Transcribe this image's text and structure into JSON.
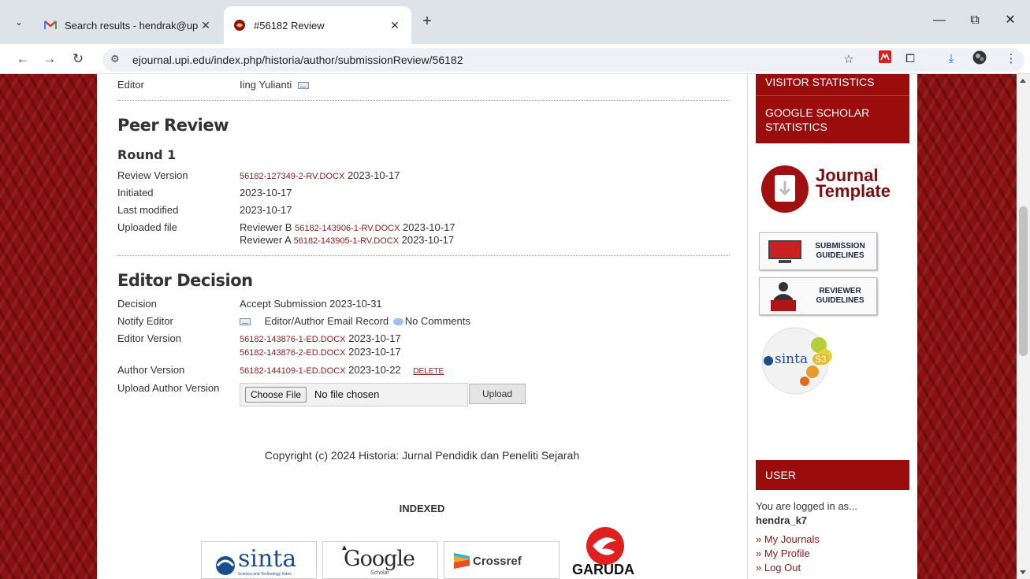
{
  "browser": {
    "tabs": [
      {
        "title": "Search results - hendrak@upi.e",
        "favicon": "gmail-icon",
        "active": false
      },
      {
        "title": "#56182 Review",
        "favicon": "ojs-icon",
        "active": true
      }
    ],
    "url": "ejournal.upi.edu/index.php/historia/author/submissionReview/56182"
  },
  "top_rows": {
    "editor_label": "Editor",
    "editor_value": "Iing Yulianti"
  },
  "peer_review": {
    "heading": "Peer Review",
    "round": "Round 1",
    "rows": {
      "review_version_label": "Review Version",
      "review_version_file": "56182-127349-2-RV.DOCX",
      "review_version_date": "2023-10-17",
      "initiated_label": "Initiated",
      "initiated_value": "2023-10-17",
      "last_modified_label": "Last modified",
      "last_modified_value": "2023-10-17",
      "uploaded_file_label": "Uploaded file",
      "reviewer_b": "Reviewer B",
      "reviewer_b_file": "56182-143906-1-RV.DOCX",
      "reviewer_b_date": "2023-10-17",
      "reviewer_a": "Reviewer A",
      "reviewer_a_file": "56182-143905-1-RV.DOCX",
      "reviewer_a_date": "2023-10-17"
    }
  },
  "editor_decision": {
    "heading": "Editor Decision",
    "decision_label": "Decision",
    "decision_value": "Accept Submission 2023-10-31",
    "notify_label": "Notify Editor",
    "email_record": "Editor/Author Email Record",
    "no_comments": "No Comments",
    "editor_version_label": "Editor Version",
    "editor_file_1": "56182-143876-1-ED.DOCX",
    "editor_file_1_date": "2023-10-17",
    "editor_file_2": "56182-143876-2-ED.DOCX",
    "editor_file_2_date": "2023-10-17",
    "author_version_label": "Author Version",
    "author_file": "56182-144109-1-ED.DOCX",
    "author_file_date": "2023-10-22",
    "delete_label": "DELETE",
    "upload_author_label": "Upload Author Version",
    "choose_file": "Choose File",
    "no_file": "No file chosen",
    "upload_button": "Upload"
  },
  "footer": {
    "copyright": "Copyright (c) 2024 Historia: Jurnal Pendidik dan Peneliti Sejarah",
    "indexed": "INDEXED",
    "logos": {
      "sinta": "sinta",
      "sinta_sub": "Science and Technology Index",
      "google": "Google",
      "google_sub": "Scholar",
      "crossref": "Crossref",
      "garuda": "GARUDA"
    }
  },
  "sidebar": {
    "visitor_statistics": "VISITOR STATISTICS",
    "google_scholar_statistics": "GOOGLE SCHOLAR STATISTICS",
    "journal_template_1": "Journal",
    "journal_template_2": "Template",
    "submission_guidelines_1": "SUBMISSION",
    "submission_guidelines_2": "GUIDELINES",
    "reviewer_guidelines_1": "REVIEWER",
    "reviewer_guidelines_2": "GUIDELINES",
    "sinta_badge_text": "sinta",
    "sinta_badge_level": "S3",
    "user_heading": "USER",
    "logged_in_as": "You are logged in as...",
    "username": "hendra_k7",
    "links": [
      "» My Journals",
      "» My Profile",
      "» Log Out"
    ]
  },
  "colors": {
    "brand_red": "#9b0c0c",
    "link_red": "#8b1a1a"
  }
}
